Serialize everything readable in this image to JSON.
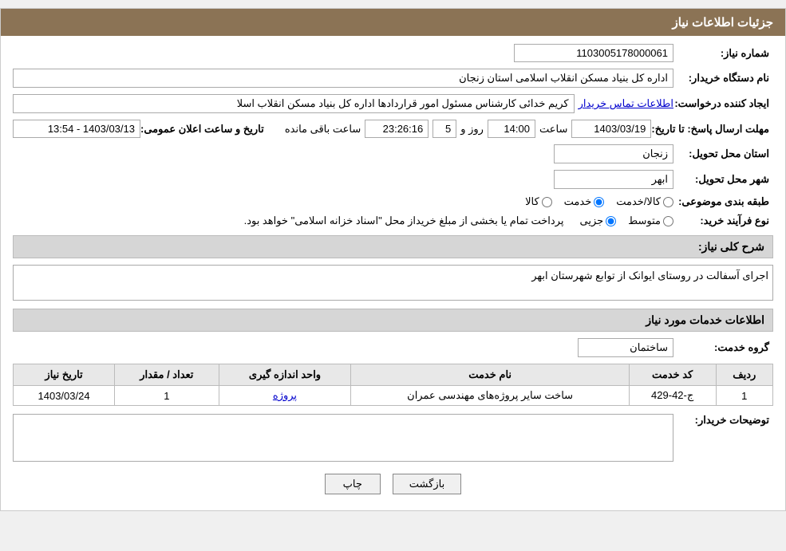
{
  "header": {
    "title": "جزئیات اطلاعات نیاز"
  },
  "fields": {
    "shomara_niaz_label": "شماره نیاز:",
    "shomara_niaz_value": "1103005178000061",
    "nam_dastgah_label": "نام دستگاه خریدار:",
    "nam_dastgah_value": "اداره کل بنیاد مسکن انقلاب اسلامی استان زنجان",
    "ijad_konande_label": "ایجاد کننده درخواست:",
    "ijad_konande_value": "کریم خدائی کارشناس مسئول امور قراردادها اداره کل بنیاد مسکن انقلاب اسلا",
    "ijad_konande_link": "اطلاعات تماس خریدار",
    "mohlat_label": "مهلت ارسال پاسخ: تا تاریخ:",
    "tarikh_value": "1403/03/19",
    "saat_label": "ساعت",
    "saat_value": "14:00",
    "rooz_label": "روز و",
    "rooz_value": "5",
    "saat_baqi_value": "23:26:16",
    "saat_baqi_label": "ساعت باقی مانده",
    "tarikh_va_saat_label": "تاریخ و ساعت اعلان عمومی:",
    "tarikh_aalan_value": "1403/03/13 - 13:54",
    "ostan_label": "استان محل تحویل:",
    "ostan_value": "زنجان",
    "shahr_label": "شهر محل تحویل:",
    "shahr_value": "ابهر",
    "tabaqe_label": "طبقه بندی موضوعی:",
    "radio_kala": "کالا",
    "radio_khedmat": "خدمت",
    "radio_kala_khedmat": "کالا/خدمت",
    "radio_kala_checked": false,
    "radio_khedmat_checked": true,
    "radio_kala_khedmat_checked": false,
    "nooe_farayand_label": "نوع فرآیند خرید:",
    "radio_jozii": "جزیی",
    "radio_mottavasset": "متوسط",
    "farayand_note": "پرداخت تمام یا بخشی از مبلغ خریداز محل \"اسناد خزانه اسلامی\" خواهد بود.",
    "sharh_label": "شرح کلی نیاز:",
    "sharh_value": "اجرای آسفالت در روستای ایوانک از توابع شهرستان ابهر",
    "khadamat_section": "اطلاعات خدمات مورد نیاز",
    "gorooh_label": "گروه خدمت:",
    "gorooh_value": "ساختمان",
    "table_headers": [
      "ردیف",
      "کد خدمت",
      "نام خدمت",
      "واحد اندازه گیری",
      "تعداد / مقدار",
      "تاریخ نیاز"
    ],
    "table_rows": [
      {
        "radif": "1",
        "kod_khedmat": "ج-42-429",
        "nam_khedmat": "ساخت سایر پروژه‌های مهندسی عمران",
        "vahed": "پروژه",
        "tedad": "1",
        "tarikh": "1403/03/24"
      }
    ],
    "toseeh_label": "توضیحات خریدار:",
    "toseeh_value": "",
    "btn_chap": "چاپ",
    "btn_bazgasht": "بازگشت"
  }
}
